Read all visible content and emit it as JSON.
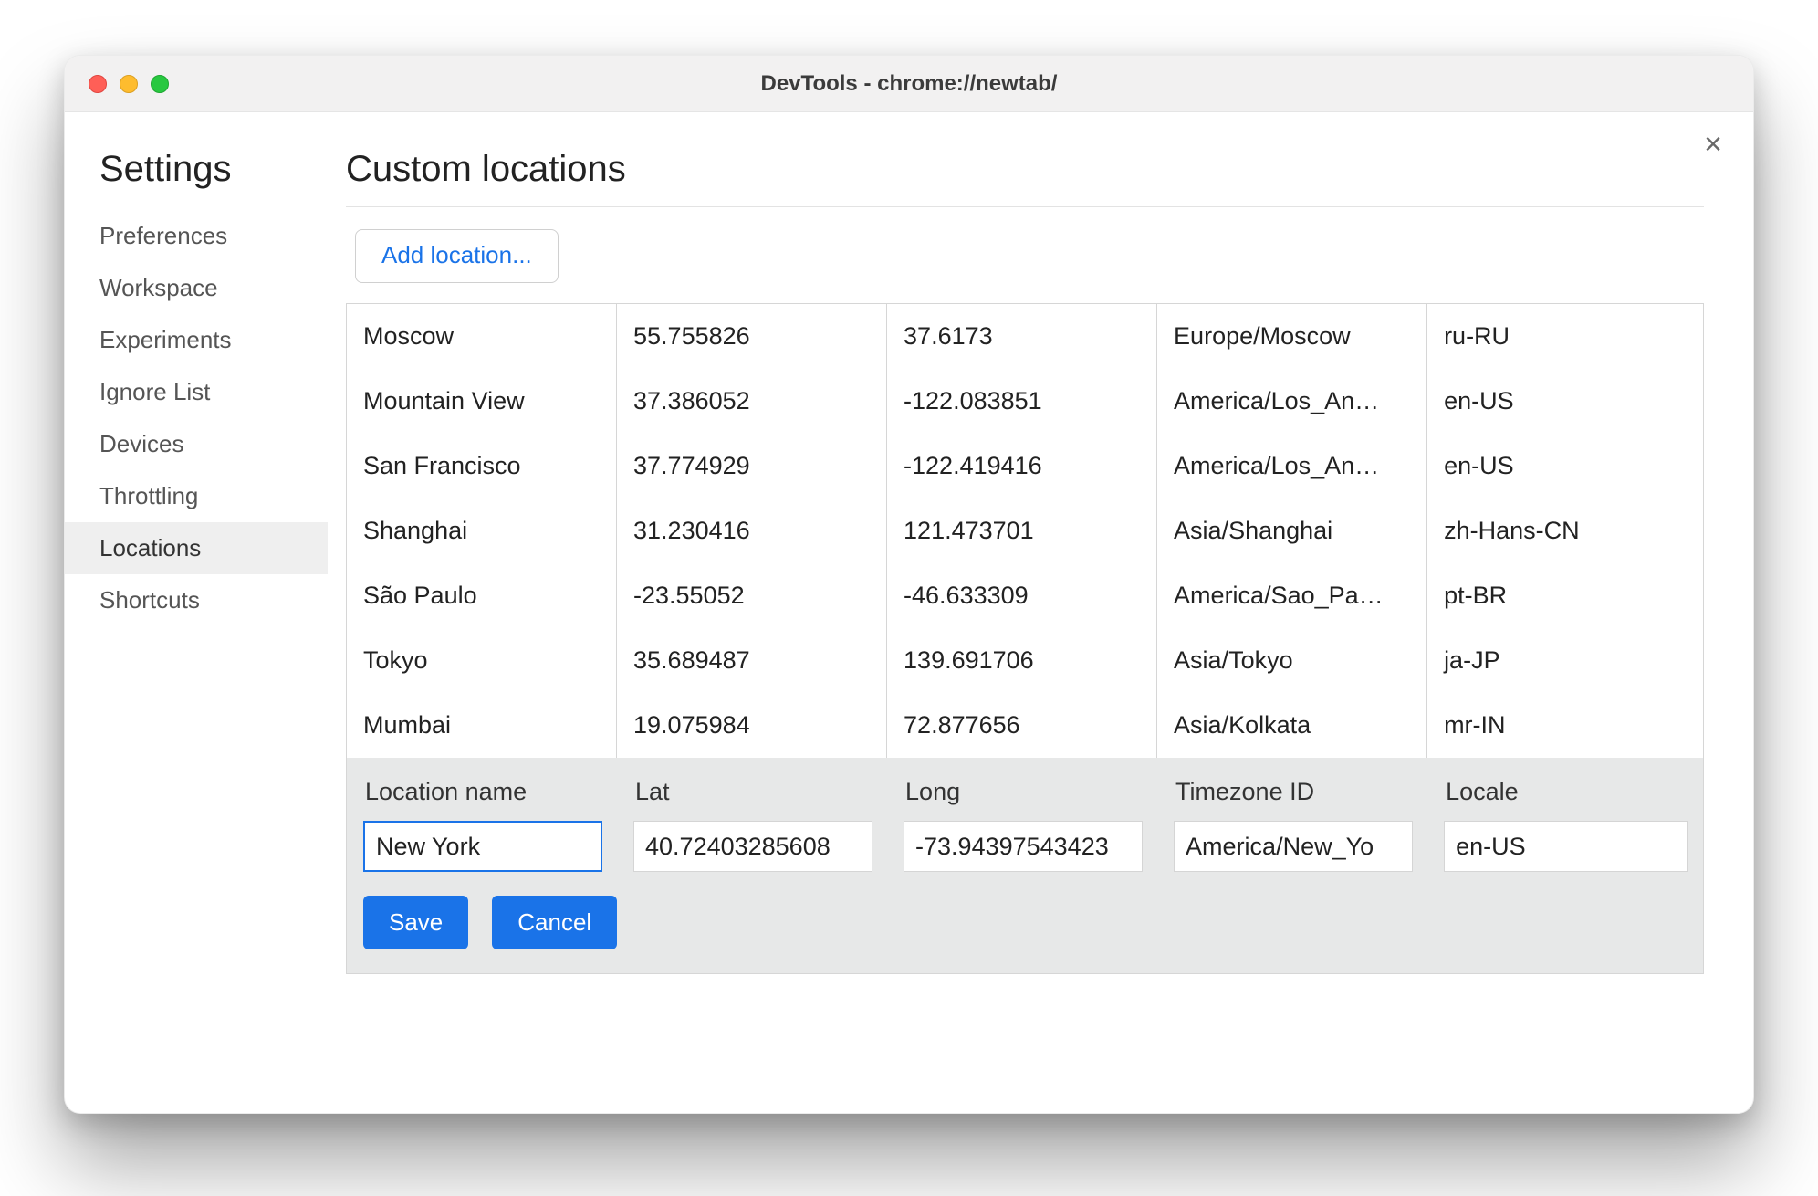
{
  "window": {
    "title": "DevTools - chrome://newtab/"
  },
  "close_glyph": "×",
  "sidebar": {
    "title": "Settings",
    "items": [
      {
        "label": "Preferences",
        "active": false
      },
      {
        "label": "Workspace",
        "active": false
      },
      {
        "label": "Experiments",
        "active": false
      },
      {
        "label": "Ignore List",
        "active": false
      },
      {
        "label": "Devices",
        "active": false
      },
      {
        "label": "Throttling",
        "active": false
      },
      {
        "label": "Locations",
        "active": true
      },
      {
        "label": "Shortcuts",
        "active": false
      }
    ]
  },
  "page": {
    "title": "Custom locations",
    "add_button": "Add location..."
  },
  "locations": [
    {
      "name": "Moscow",
      "lat": "55.755826",
      "long": "37.6173",
      "tz": "Europe/Moscow",
      "locale": "ru-RU"
    },
    {
      "name": "Mountain View",
      "lat": "37.386052",
      "long": "-122.083851",
      "tz": "America/Los_An…",
      "locale": "en-US"
    },
    {
      "name": "San Francisco",
      "lat": "37.774929",
      "long": "-122.419416",
      "tz": "America/Los_An…",
      "locale": "en-US"
    },
    {
      "name": "Shanghai",
      "lat": "31.230416",
      "long": "121.473701",
      "tz": "Asia/Shanghai",
      "locale": "zh-Hans-CN"
    },
    {
      "name": "São Paulo",
      "lat": "-23.55052",
      "long": "-46.633309",
      "tz": "America/Sao_Pa…",
      "locale": "pt-BR"
    },
    {
      "name": "Tokyo",
      "lat": "35.689487",
      "long": "139.691706",
      "tz": "Asia/Tokyo",
      "locale": "ja-JP"
    },
    {
      "name": "Mumbai",
      "lat": "19.075984",
      "long": "72.877656",
      "tz": "Asia/Kolkata",
      "locale": "mr-IN"
    }
  ],
  "edit": {
    "headers": {
      "name": "Location name",
      "lat": "Lat",
      "long": "Long",
      "tz": "Timezone ID",
      "locale": "Locale"
    },
    "values": {
      "name": "New York",
      "lat": "40.72403285608",
      "long": "-73.94397543423",
      "tz": "America/New_Yo",
      "locale": "en-US"
    },
    "save": "Save",
    "cancel": "Cancel"
  }
}
